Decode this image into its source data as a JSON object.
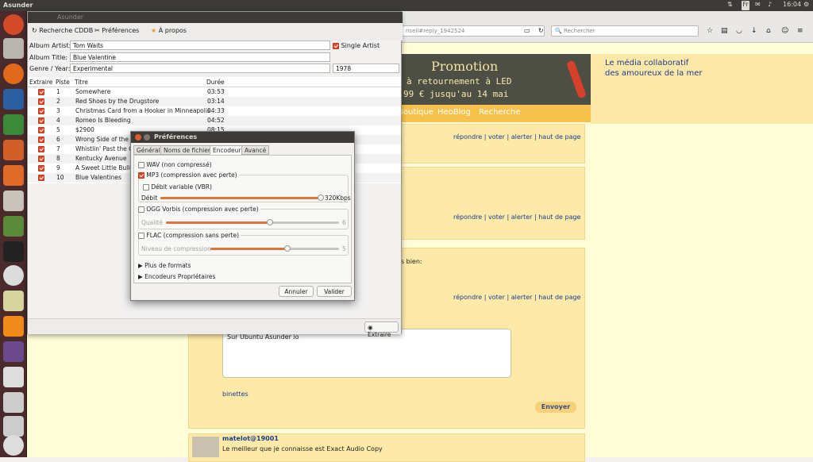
{
  "topbar": {
    "app_title": "Asunder",
    "fr": "Fr",
    "clock": "16:04"
  },
  "browser": {
    "url": "nseil#reply_1942524",
    "search_placeholder": "Rechercher",
    "promo_title": "Promotion",
    "promo_line1": "à retournement à LED",
    "promo_line2": "99 € jusqu'au 14 mai",
    "tagline1": "Le média collaboratif",
    "tagline2": "des amoureux de la mer",
    "nav": [
      "Boutique",
      "HeoBlog",
      "Recherche"
    ],
    "actions": [
      "répondre",
      "voter",
      "alerter",
      "haut de page"
    ],
    "comment_fragment": "ès bien:",
    "textarea_value": "Sur Ubuntu Asunder io",
    "username1": "binettes",
    "send_label": "Envoyer",
    "username2": "matelot@19001",
    "comment2": "Le meilleur que je connaisse est Exact Audio Copy"
  },
  "asunder": {
    "title": "Asunder",
    "toolbar": {
      "cddb": "Recherche CDDB",
      "prefs": "Préférences",
      "about": "À propos"
    },
    "labels": {
      "artist": "Album Artist:",
      "album": "Album Title:",
      "genre": "Genre / Year:",
      "single": "Single Artist"
    },
    "values": {
      "artist": "Tom Waits",
      "album": "Blue Valentine",
      "genre": "Experimental",
      "year": "1978"
    },
    "columns": {
      "rip": "Extraire",
      "track": "Piste",
      "title": "Titre",
      "duration": "Durée"
    },
    "tracks": [
      {
        "n": "1",
        "title": "Somewhere",
        "dur": "03:53"
      },
      {
        "n": "2",
        "title": "Red Shoes by the Drugstore",
        "dur": "03:14"
      },
      {
        "n": "3",
        "title": "Christmas Card from a Hooker in Minneapolis",
        "dur": "04:33"
      },
      {
        "n": "4",
        "title": "Romeo Is Bleeding",
        "dur": "04:52"
      },
      {
        "n": "5",
        "title": "$2900",
        "dur": "08:15"
      },
      {
        "n": "6",
        "title": "Wrong Side of the R",
        "dur": ""
      },
      {
        "n": "7",
        "title": "Whistlin' Past the G",
        "dur": ""
      },
      {
        "n": "8",
        "title": "Kentucky Avenue",
        "dur": ""
      },
      {
        "n": "9",
        "title": "A Sweet Little Bullet",
        "dur": ""
      },
      {
        "n": "10",
        "title": "Blue Valentines",
        "dur": ""
      }
    ],
    "extract_label": "Extraire"
  },
  "prefs": {
    "title": "Préférences",
    "tabs": [
      "Général",
      "Noms de fichier",
      "Encodeur",
      "Avancé"
    ],
    "wav": "WAV (non compressé)",
    "mp3": "MP3 (compression avec perte)",
    "vbr": "Débit variable (VBR)",
    "bitrate_label": "Débit",
    "bitrate_value": "320Kbps",
    "bitrate_level": 1.0,
    "ogg": "OGG Vorbis (compression avec perte)",
    "quality_label": "Qualité",
    "quality_value": "6",
    "quality_level": 0.6,
    "flac": "FLAC (compression sans perte)",
    "compression_label": "Niveau de compression",
    "compression_value": "5",
    "compression_level": 0.6,
    "more_formats": "Plus de formats",
    "proprietary": "Encodeurs Propriétaires",
    "cancel": "Annuler",
    "ok": "Valider"
  }
}
